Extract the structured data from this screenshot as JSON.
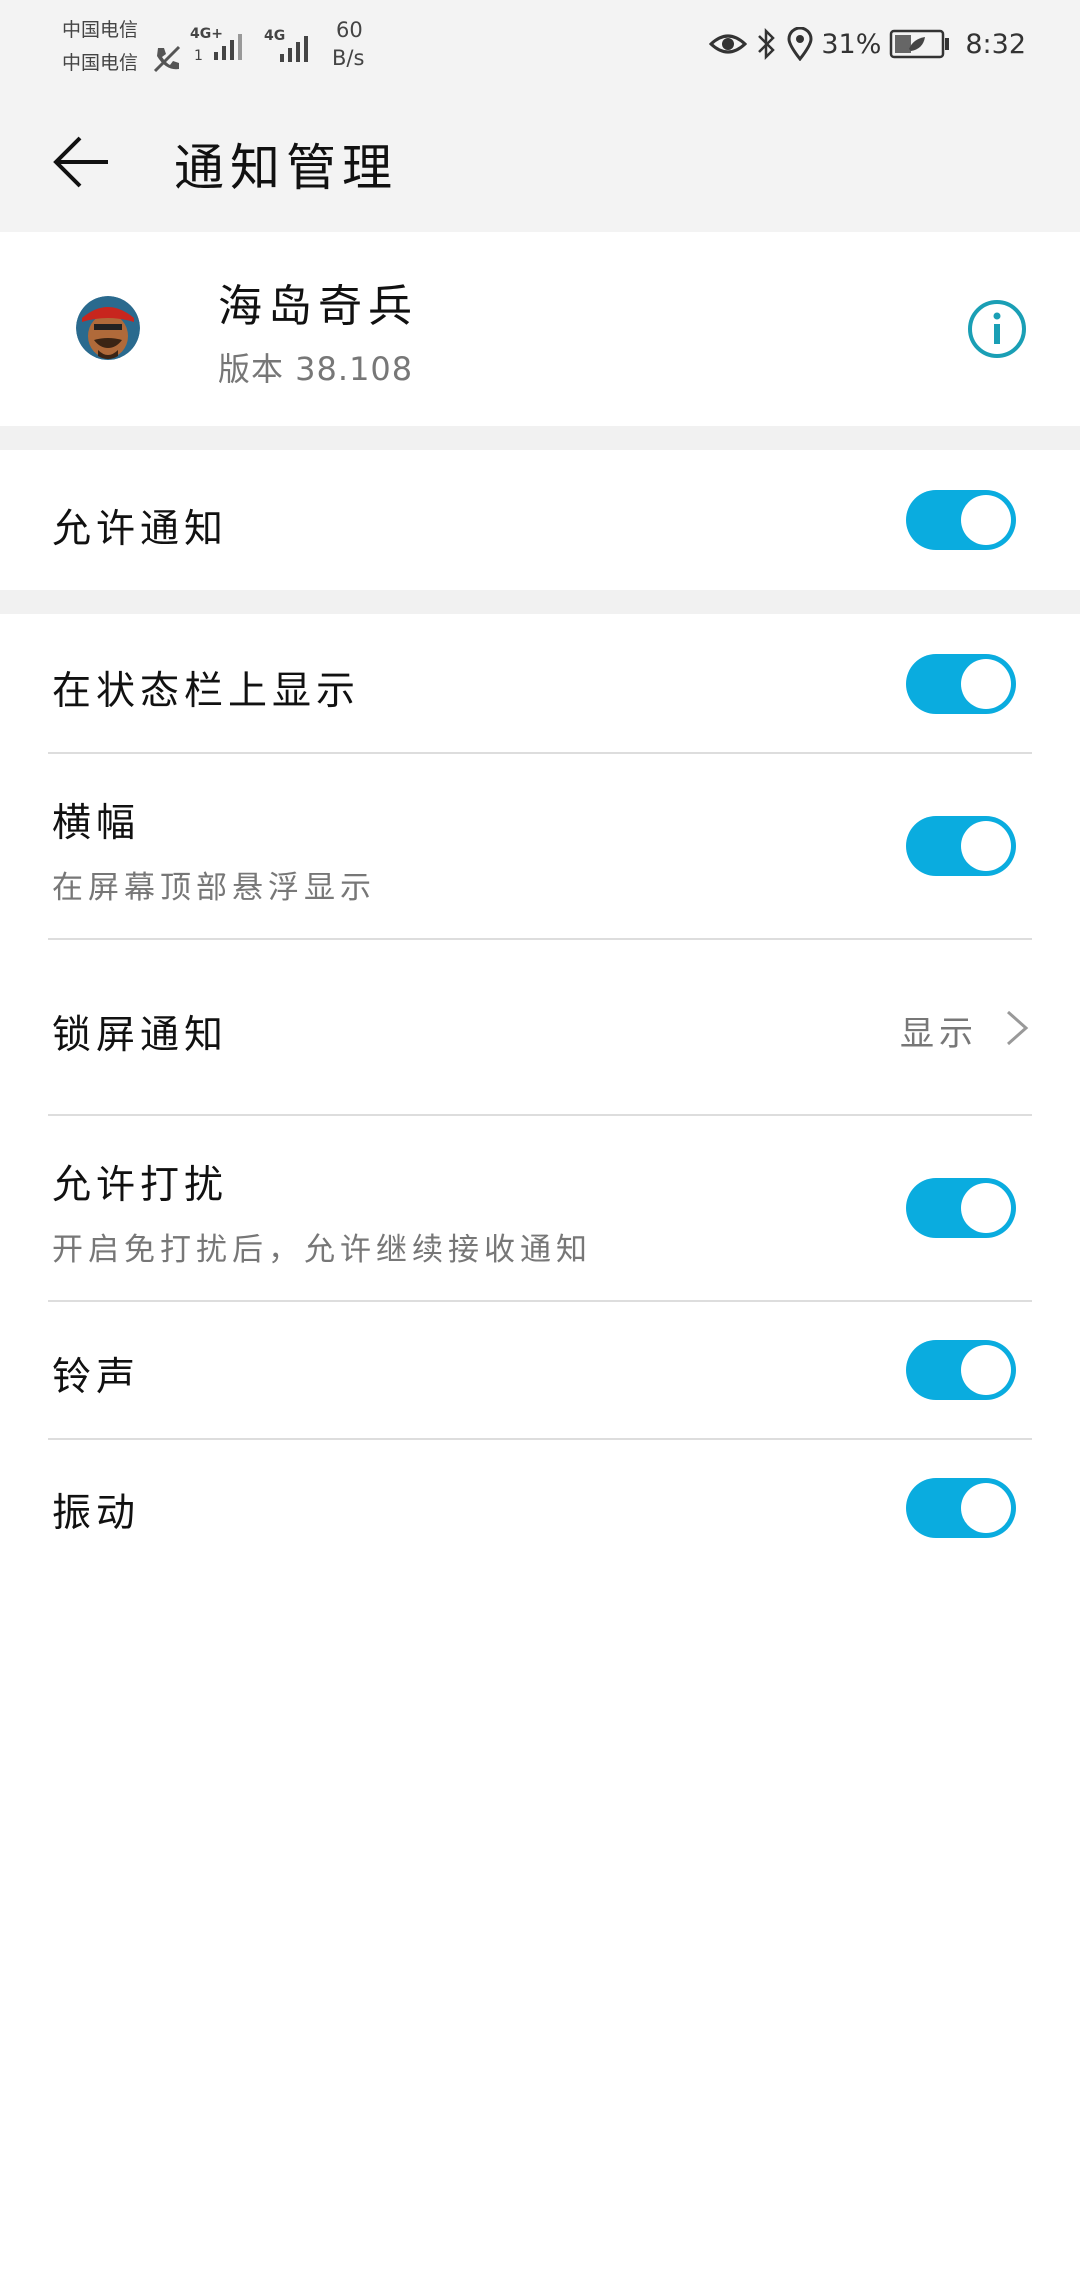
{
  "status_bar": {
    "carrier_1": "中国电信",
    "carrier_2": "中国电信",
    "net_1": "4G+",
    "net_2": "4G",
    "speed_value": "60",
    "speed_unit": "B/s",
    "battery": "31%",
    "time": "8:32"
  },
  "header": {
    "title": "通知管理"
  },
  "app": {
    "name": "海岛奇兵",
    "version": "版本 38.108"
  },
  "settings": {
    "allow_notifications": {
      "label": "允许通知",
      "on": true
    },
    "status_bar_display": {
      "label": "在状态栏上显示",
      "on": true
    },
    "banner": {
      "label": "横幅",
      "sub": "在屏幕顶部悬浮显示",
      "on": true
    },
    "lock_screen": {
      "label": "锁屏通知",
      "value": "显示"
    },
    "allow_interrupt": {
      "label": "允许打扰",
      "sub": "开启免打扰后，允许继续接收通知",
      "on": true
    },
    "ringtone": {
      "label": "铃声",
      "on": true
    },
    "vibration": {
      "label": "振动",
      "on": true
    }
  },
  "colors": {
    "accent": "#0aacdf",
    "info_icon": "#1a9fb5",
    "background": "#f3f3f3"
  }
}
